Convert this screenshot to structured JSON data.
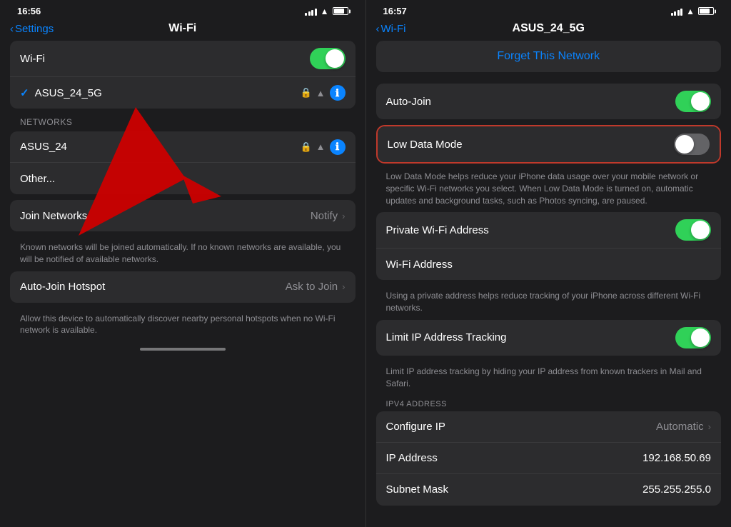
{
  "left_phone": {
    "status_time": "16:56",
    "nav": {
      "back_label": "Settings",
      "title": "Wi-Fi"
    },
    "wifi_row": {
      "label": "Wi-Fi",
      "toggle": "on"
    },
    "connected_network": {
      "name": "ASUS_24_5G",
      "connected": true
    },
    "section_label": "NETWORKS",
    "networks": [
      {
        "name": "ASUS_24"
      },
      {
        "name": "Other..."
      }
    ],
    "join_networks": {
      "label": "Join Networks",
      "value": "Notify",
      "desc": "Known networks will be joined automatically. If no known networks are available, you will be notified of available networks."
    },
    "auto_join_hotspot": {
      "label": "Auto-Join Hotspot",
      "value": "Ask to Join",
      "desc": "Allow this device to automatically discover nearby personal hotspots when no Wi-Fi network is available."
    }
  },
  "right_phone": {
    "status_time": "16:57",
    "nav": {
      "back_label": "Wi-Fi",
      "title": "ASUS_24_5G"
    },
    "forget_network": "Forget This Network",
    "auto_join": {
      "label": "Auto-Join",
      "toggle": "on"
    },
    "low_data_mode": {
      "label": "Low Data Mode",
      "toggle": "off",
      "desc": "Low Data Mode helps reduce your iPhone data usage over your mobile network or specific Wi-Fi networks you select. When Low Data Mode is turned on, automatic updates and background tasks, such as Photos syncing, are paused."
    },
    "private_wifi": {
      "label": "Private Wi-Fi Address",
      "toggle": "on"
    },
    "wifi_address": {
      "label": "Wi-Fi Address",
      "desc": "Using a private address helps reduce tracking of your iPhone across different Wi-Fi networks."
    },
    "limit_ip": {
      "label": "Limit IP Address Tracking",
      "toggle": "on",
      "desc": "Limit IP address tracking by hiding your IP address from known trackers in Mail and Safari."
    },
    "ipv4_section": "IPV4 ADDRESS",
    "configure_ip": {
      "label": "Configure IP",
      "value": "Automatic"
    },
    "ip_address": {
      "label": "IP Address",
      "value": "192.168.50.69"
    },
    "subnet_mask": {
      "label": "Subnet Mask",
      "value": "255.255.255.0"
    }
  }
}
